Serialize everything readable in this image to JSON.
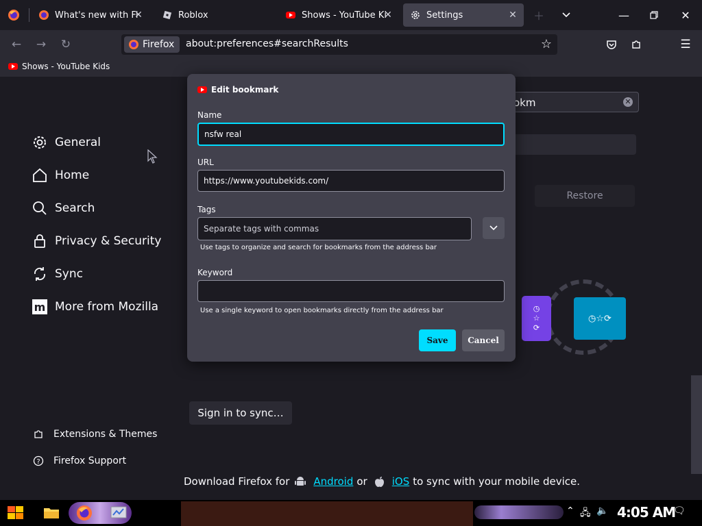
{
  "tabs": [
    {
      "title": "What's new with Firef",
      "active": false,
      "favicon": "firefox-icon"
    },
    {
      "title": "Roblox",
      "active": false,
      "favicon": "roblox-icon"
    },
    {
      "title": "Shows - YouTube Kids",
      "active": false,
      "favicon": "youtube-icon"
    },
    {
      "title": "Settings",
      "active": true,
      "favicon": "gear-icon"
    }
  ],
  "navbar": {
    "identity_label": "Firefox",
    "url": "about:preferences#searchResults"
  },
  "bookmarks_toolbar": {
    "items": [
      {
        "label": "Shows - YouTube Kids",
        "icon": "youtube-icon"
      }
    ]
  },
  "sidebar": {
    "categories": [
      {
        "label": "General",
        "icon": "gear-icon"
      },
      {
        "label": "Home",
        "icon": "home-icon"
      },
      {
        "label": "Search",
        "icon": "search-icon"
      },
      {
        "label": "Privacy & Security",
        "icon": "lock-icon"
      },
      {
        "label": "Sync",
        "icon": "sync-icon"
      },
      {
        "label": "More from Mozilla",
        "icon": "mozilla-icon"
      }
    ],
    "footer": [
      {
        "label": "Extensions & Themes",
        "icon": "puzzle-icon"
      },
      {
        "label": "Firefox Support",
        "icon": "help-icon"
      }
    ]
  },
  "content": {
    "search_value": "okm",
    "restore_label": "Restore",
    "sync_button": "Sign in to sync…",
    "download": {
      "prefix": "Download Firefox for",
      "android": "Android",
      "or": "or",
      "ios": "iOS",
      "suffix": "to sync with your mobile device."
    }
  },
  "dialog": {
    "title": "Edit bookmark",
    "name_label": "Name",
    "name_value": "nsfw real",
    "url_label": "URL",
    "url_value": "https://www.youtubekids.com/",
    "tags_label": "Tags",
    "tags_placeholder": "Separate tags with commas",
    "tags_hint": "Use tags to organize and search for bookmarks from the address bar",
    "keyword_label": "Keyword",
    "keyword_value": "",
    "keyword_hint": "Use a single keyword to open bookmarks directly from the address bar",
    "save_label": "Save",
    "cancel_label": "Cancel"
  },
  "taskbar": {
    "clock": "4:05 AM"
  },
  "colors": {
    "accent": "#00ddff",
    "dialog_bg": "#42414d",
    "page_bg": "#1c1b22"
  }
}
